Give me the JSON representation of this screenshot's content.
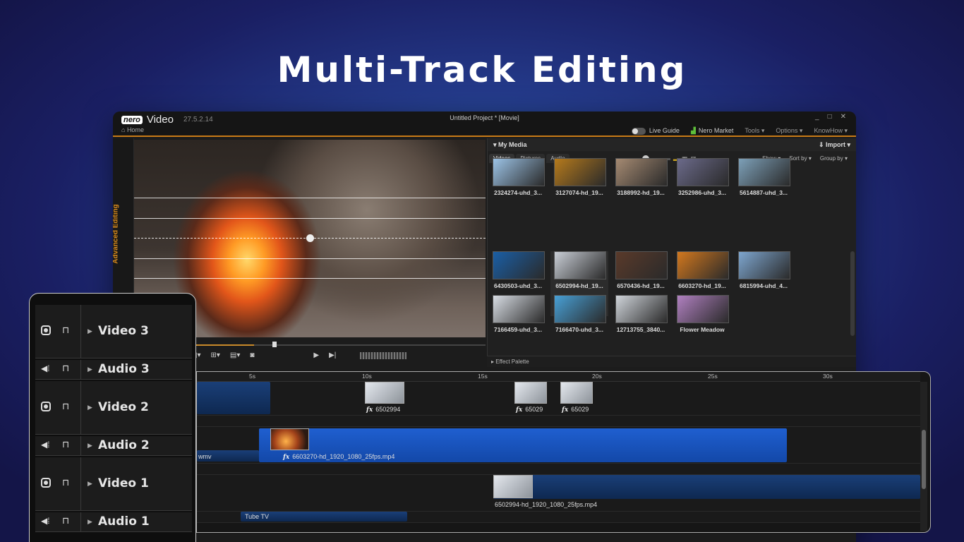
{
  "hero": {
    "title": "Multi-Track Editing"
  },
  "app": {
    "logo_badge": "nero",
    "name": "Video",
    "version": "27.5.2.14",
    "home": "Home",
    "project_title": "Untitled Project * [Movie]",
    "window_controls": [
      "_",
      "□",
      "✕"
    ],
    "menu": {
      "live_guide": "Live Guide",
      "nero_market": "Nero Market",
      "tools": "Tools ▾",
      "options": "Options ▾",
      "knowhow": "KnowHow ▾"
    },
    "side_label": "Advanced Editing"
  },
  "media": {
    "header": "▾ My Media",
    "import": "⇓ Import ▾",
    "tabs": [
      "Videos",
      "Pictures",
      "Audio"
    ],
    "menu": [
      "Show ▾",
      "Sort by ▾",
      "Group by ▾"
    ],
    "thumbs": [
      {
        "label": "2324274-uhd_3...",
        "color": "#9cc3e6"
      },
      {
        "label": "3127074-hd_19...",
        "color": "#b57a1c"
      },
      {
        "label": "3188992-hd_19...",
        "color": "#a58a72"
      },
      {
        "label": "3252986-uhd_3...",
        "color": "#6b6a8a"
      },
      {
        "label": "5614887-uhd_3...",
        "color": "#7da0b8"
      },
      {
        "label": "6430503-uhd_3...",
        "color": "#1a5fa6"
      },
      {
        "label": "6502994-hd_19...",
        "color": "#c9ced6"
      },
      {
        "label": "6570436-hd_19...",
        "color": "#5a3a2a"
      },
      {
        "label": "6603270-hd_19...",
        "color": "#d2781e"
      },
      {
        "label": "6815994-uhd_4...",
        "color": "#7ea6cf"
      },
      {
        "label": "7166459-uhd_3...",
        "color": "#d8dde4"
      },
      {
        "label": "7166470-uhd_3...",
        "color": "#48a0d6"
      },
      {
        "label": "12713755_3840...",
        "color": "#cfd4da"
      },
      {
        "label": "Flower Meadow",
        "color": "#b080c0"
      }
    ],
    "effect_palette": "▸ Effect Palette"
  },
  "timeline": {
    "ticks": [
      "5s",
      "10s",
      "15s",
      "20s",
      "25s",
      "30s"
    ],
    "clips": {
      "v3_a": "6502994",
      "v3_b": "65029",
      "v3_c": "65029",
      "v2_left": "wmv",
      "v2_main": "6603270-hd_1920_1080_25fps.mp4",
      "v1_main": "6502994-hd_1920_1080_25fps.mp4",
      "a1_clip": "Tube TV"
    },
    "fx": "fx"
  },
  "tracks": [
    {
      "name": "Video 3",
      "type": "video"
    },
    {
      "name": "Audio 3",
      "type": "audio"
    },
    {
      "name": "Video 2",
      "type": "video"
    },
    {
      "name": "Audio 2",
      "type": "audio"
    },
    {
      "name": "Video 1",
      "type": "video"
    },
    {
      "name": "Audio 1",
      "type": "audio"
    }
  ],
  "icons": {
    "lock": "🔓",
    "speaker": "🔈",
    "expand": "▶"
  },
  "colors": {
    "accent": "#c97a16",
    "clip_blue": "#1f5fd0"
  }
}
